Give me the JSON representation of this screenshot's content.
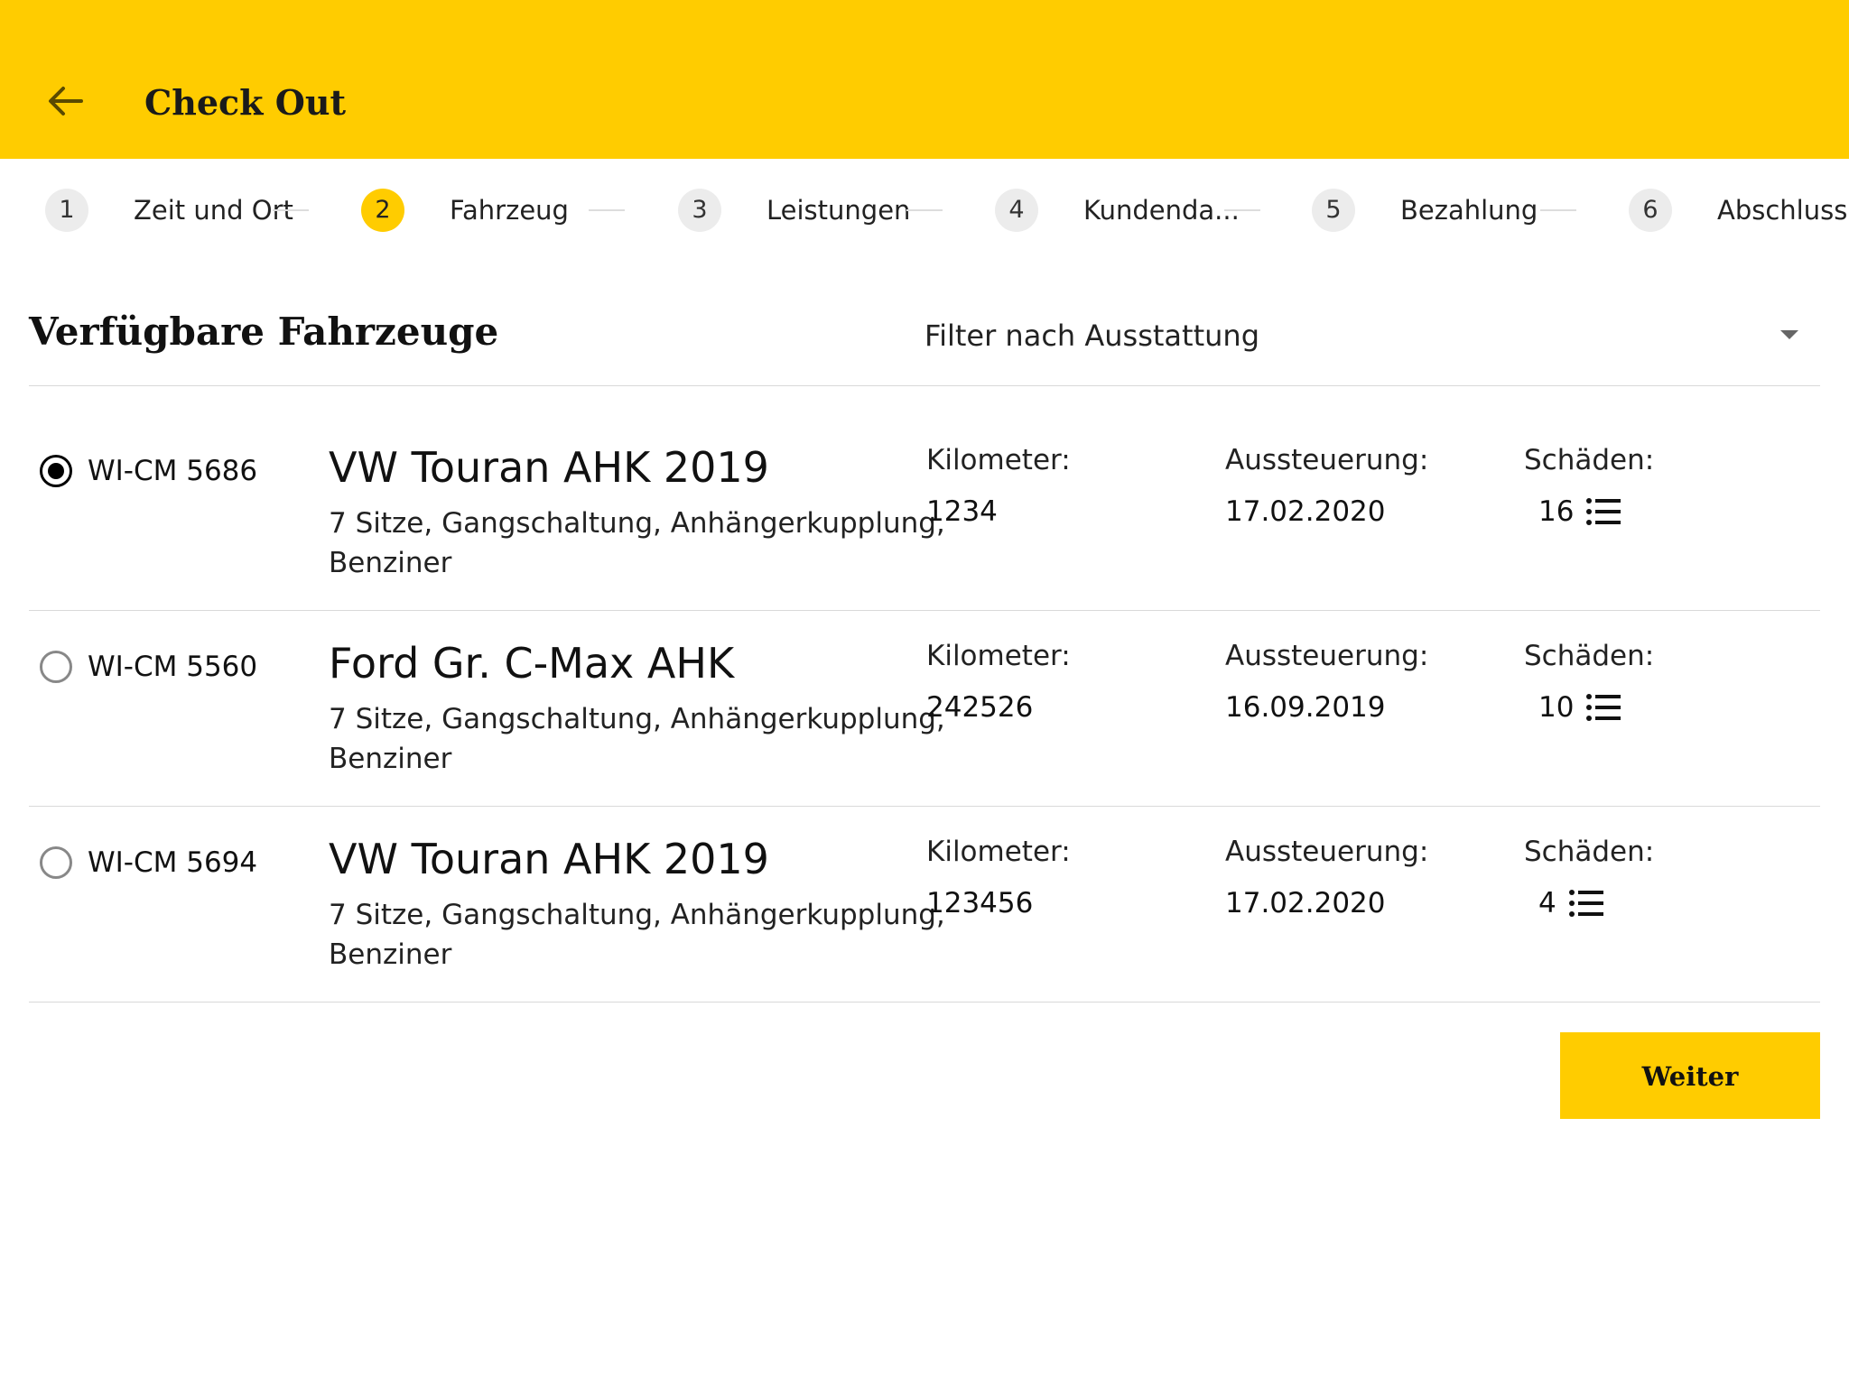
{
  "header": {
    "title": "Check Out"
  },
  "steps": [
    {
      "number": "1",
      "label": "Zeit und Ort"
    },
    {
      "number": "2",
      "label": "Fahrzeug"
    },
    {
      "number": "3",
      "label": "Leistungen"
    },
    {
      "number": "4",
      "label": "Kundenda..."
    },
    {
      "number": "5",
      "label": "Bezahlung"
    },
    {
      "number": "6",
      "label": "Abschluss"
    }
  ],
  "active_step": "2",
  "section": {
    "title": "Verfügbare Fahrzeuge",
    "filter_label": "Filter nach Ausstattung"
  },
  "labels": {
    "km": "Kilometer:",
    "aussteuerung": "Aussteuerung:",
    "schaeden": "Schäden:"
  },
  "vehicles": [
    {
      "plate": "WI-CM 5686",
      "model": "VW Touran AHK 2019",
      "features": "7 Sitze, Gangschaltung, Anhängerkupplung, Benziner",
      "km": "1234",
      "aussteuerung": "17.02.2020",
      "schaeden": "16",
      "selected": true
    },
    {
      "plate": "WI-CM 5560",
      "model": "Ford Gr. C-Max AHK",
      "features": "7 Sitze, Gangschaltung, Anhängerkupplung, Benziner",
      "km": "242526",
      "aussteuerung": "16.09.2019",
      "schaeden": "10",
      "selected": false
    },
    {
      "plate": "WI-CM 5694",
      "model": "VW Touran AHK 2019",
      "features": "7 Sitze, Gangschaltung, Anhängerkupplung, Benziner",
      "km": "123456",
      "aussteuerung": "17.02.2020",
      "schaeden": "4",
      "selected": false
    }
  ],
  "actions": {
    "next_label": "Weiter"
  },
  "colors": {
    "accent": "#FFCC00"
  }
}
